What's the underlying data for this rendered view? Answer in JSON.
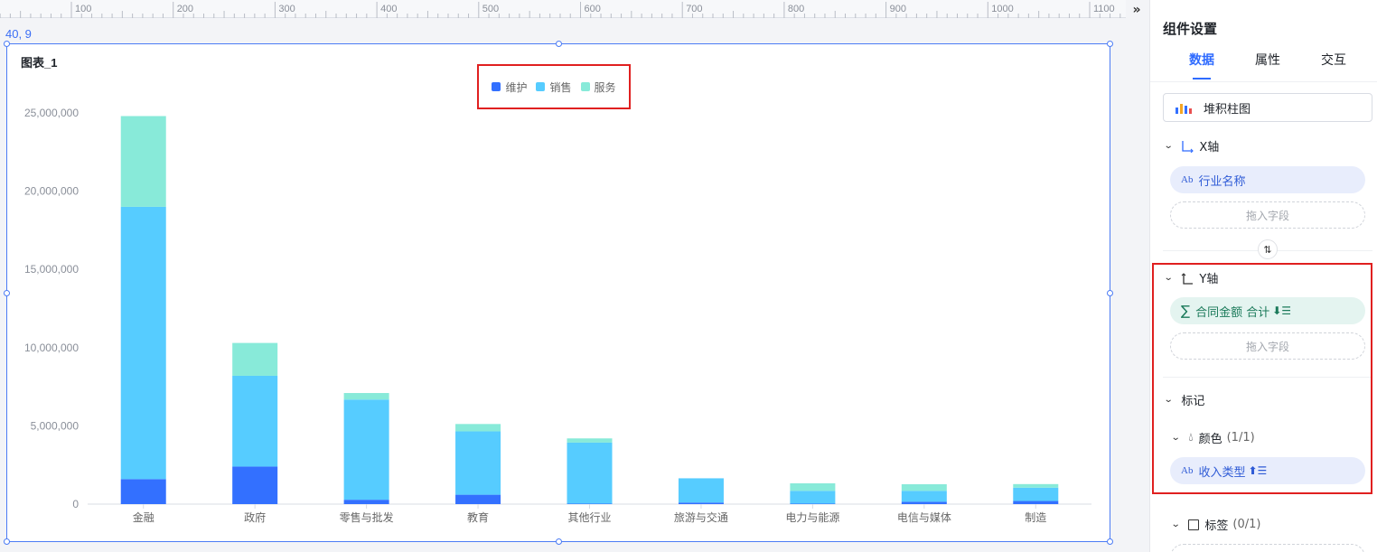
{
  "canvas": {
    "coord_readout": "40, 9",
    "ruler_labels": [
      "100",
      "200",
      "300",
      "400",
      "500",
      "600",
      "700",
      "800",
      "900",
      "1000",
      "1100"
    ],
    "expand_icon": "double-chevron-right-icon"
  },
  "chart": {
    "title": "图表_1",
    "legend": [
      {
        "name": "维护",
        "color": "#3370ff"
      },
      {
        "name": "销售",
        "color": "#56ccff"
      },
      {
        "name": "服务",
        "color": "#88ead9"
      }
    ]
  },
  "chart_data": {
    "type": "bar",
    "stacked": true,
    "categories": [
      "金融",
      "政府",
      "零售与批发",
      "教育",
      "其他行业",
      "旅游与交通",
      "电力与能源",
      "电信与媒体",
      "制造"
    ],
    "series": [
      {
        "name": "维护",
        "color": "#3370ff",
        "values": [
          1600000,
          2400000,
          280000,
          600000,
          30000,
          100000,
          30000,
          150000,
          200000
        ]
      },
      {
        "name": "销售",
        "color": "#56ccff",
        "values": [
          17400000,
          5800000,
          6400000,
          4050000,
          3900000,
          1550000,
          820000,
          700000,
          850000
        ]
      },
      {
        "name": "服务",
        "color": "#88ead9",
        "values": [
          5800000,
          2100000,
          420000,
          470000,
          270000,
          0,
          480000,
          420000,
          230000
        ]
      }
    ],
    "y_ticks": [
      "0",
      "5,000,000",
      "10,000,000",
      "15,000,000",
      "20,000,000",
      "25,000,000"
    ],
    "ylim": [
      0,
      25000000
    ],
    "grid": false,
    "legend_position": "top-center"
  },
  "panel": {
    "title": "组件设置",
    "tabs": [
      {
        "label": "数据",
        "active": true
      },
      {
        "label": "属性",
        "active": false
      },
      {
        "label": "交互",
        "active": false
      }
    ],
    "chart_type": "堆积柱图",
    "x_axis": {
      "label": "X轴",
      "field": "行业名称",
      "field_prefix": "Ab",
      "drop_placeholder": "拖入字段"
    },
    "y_axis": {
      "label": "Y轴",
      "field": "合同金额 合计",
      "drop_placeholder": "拖入字段"
    },
    "marks": {
      "label": "标记",
      "color": {
        "label": "颜色",
        "count": "(1/1)",
        "field": "收入类型",
        "field_prefix": "Ab"
      },
      "tag": {
        "label": "标签",
        "count": "(0/1)"
      }
    },
    "accent_color": "#2f6bff",
    "highlight_color": "#e02020"
  }
}
